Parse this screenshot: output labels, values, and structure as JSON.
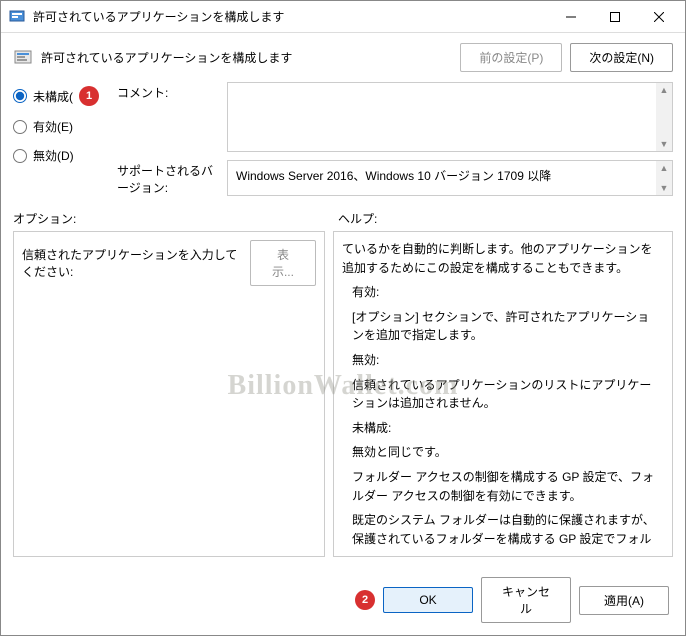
{
  "window": {
    "title": "許可されているアプリケーションを構成します"
  },
  "header": {
    "title": "許可されているアプリケーションを構成します",
    "prev": "前の設定(P)",
    "next": "次の設定(N)"
  },
  "radios": {
    "notconfigured": "未構成(",
    "enabled": "有効(E)",
    "disabled": "無効(D)"
  },
  "labels": {
    "comment": "コメント:",
    "supported": "サポートされるバージョン:",
    "options": "オプション:",
    "help": "ヘルプ:"
  },
  "supported_text": "Windows Server 2016、Windows 10 バージョン 1709 以降",
  "options": {
    "trusted_label": "信頼されたアプリケーションを入力してください:",
    "show_btn": "表示..."
  },
  "help": {
    "p1": "ているかを自動的に判断します。他のアプリケーションを追加するためにこの設定を構成することもできます。",
    "t2": "有効:",
    "p2": "[オプション] セクションで、許可されたアプリケーションを追加で指定します。",
    "t3": "無効:",
    "p3": "信頼されているアプリケーションのリストにアプリケーションは追加されません。",
    "t4": "未構成:",
    "p4": "無効と同じです。",
    "p5": "フォルダー アクセスの制御を構成する GP 設定で、フォルダー アクセスの制御を有効にできます。",
    "p6": "既定のシステム フォルダーは自動的に保護されますが、保護されているフォルダーを構成する GP 設定でフォルダーを追加できます。"
  },
  "buttons": {
    "ok": "OK",
    "cancel": "キャンセル",
    "apply": "適用(A)"
  },
  "badges": {
    "b1": "1",
    "b2": "2"
  },
  "watermark": "BillionWallet.com"
}
